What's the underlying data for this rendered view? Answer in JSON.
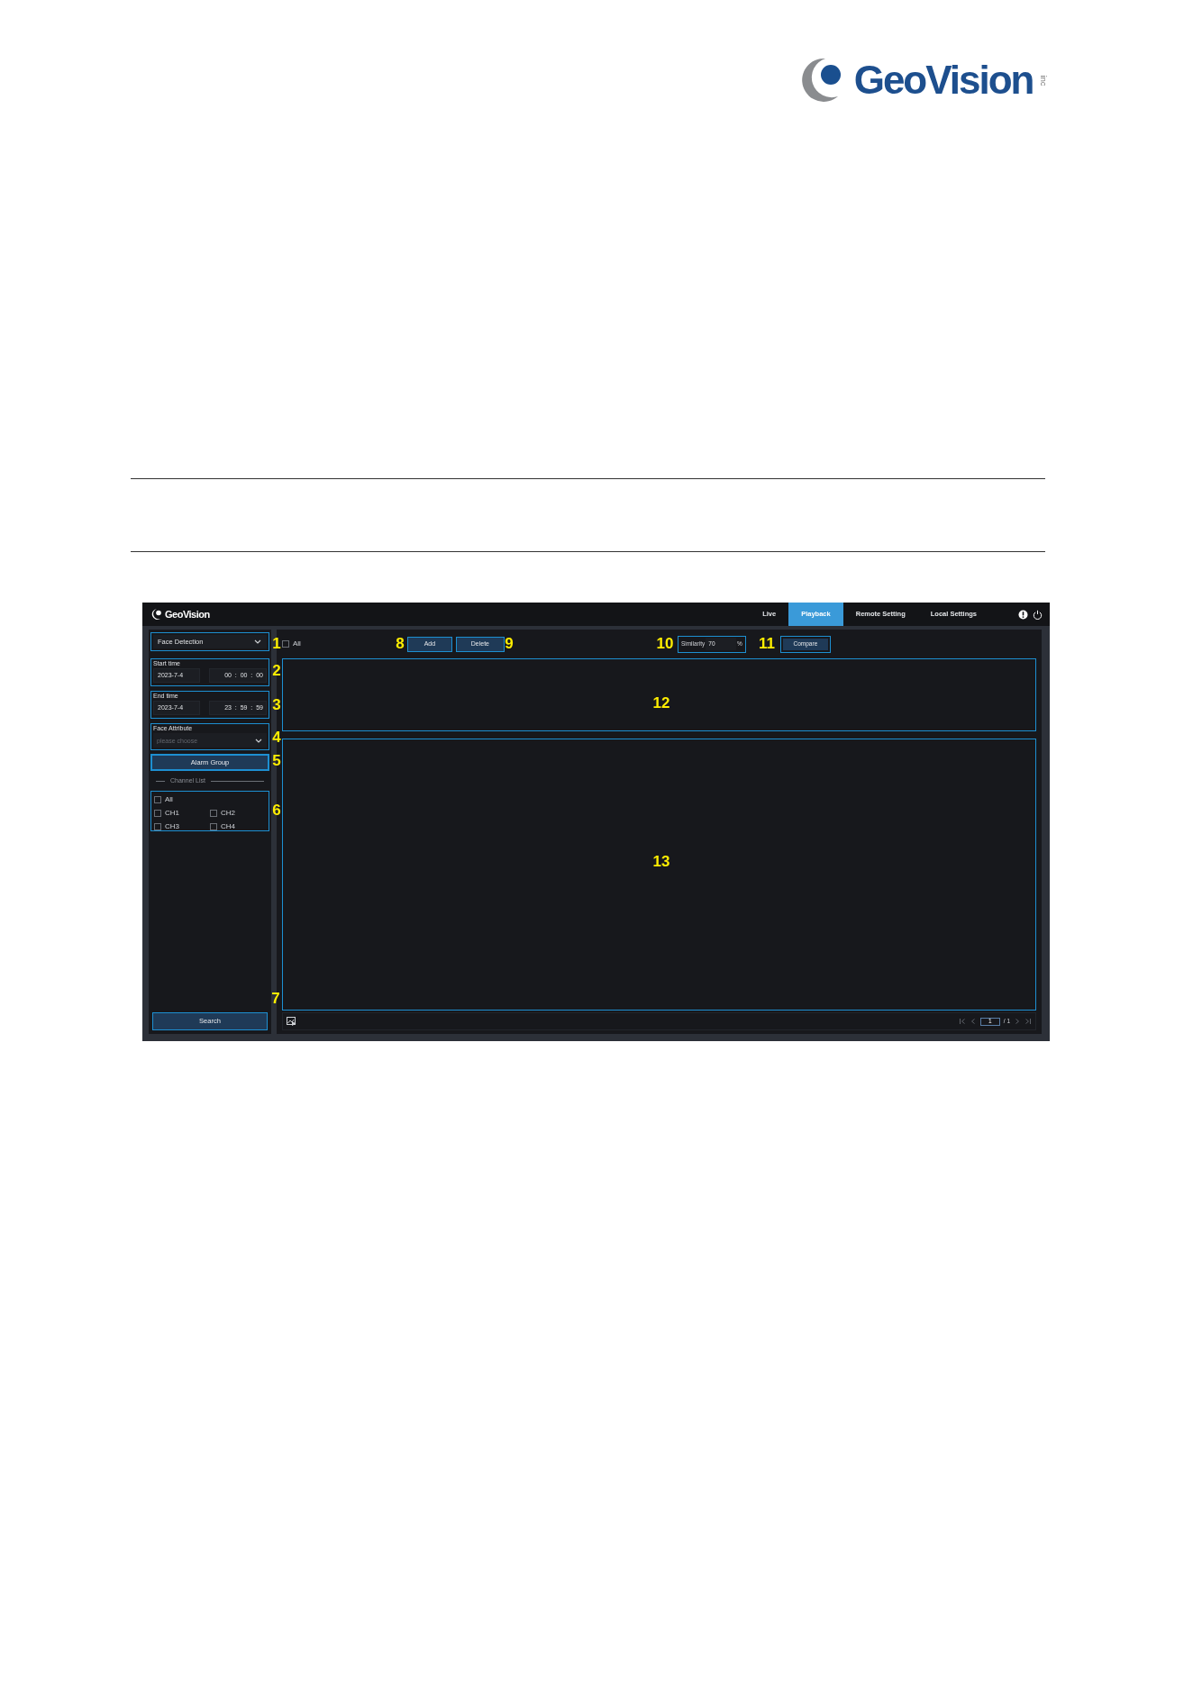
{
  "logo": {
    "name": "GeoVision",
    "suffix": "inc"
  },
  "app": {
    "brand": "GeoVision",
    "nav": [
      {
        "label": "Live",
        "selected": false
      },
      {
        "label": "Playback",
        "selected": true
      },
      {
        "label": "Remote Setting",
        "selected": false
      },
      {
        "label": "Local Settings",
        "selected": false
      }
    ],
    "sidebar": {
      "mode": "Face Detection",
      "times": [
        {
          "label": "Start time",
          "date": "2023-7-4",
          "time": "00  :  00  :  00"
        },
        {
          "label": "End time",
          "date": "2023-7-4",
          "time": "23  :  59  :  59"
        }
      ],
      "attribute": {
        "label": "Face Attribute",
        "placeholder": "please choose"
      },
      "alarm_button": "Alarm Group",
      "channel_heading": "Channel List",
      "channels": [
        {
          "label": "All",
          "checked": false
        },
        {
          "label": "CH1",
          "checked": false
        },
        {
          "label": "CH2",
          "checked": false
        },
        {
          "label": "CH3",
          "checked": false
        },
        {
          "label": "CH4",
          "checked": false
        }
      ],
      "search_button": "Search"
    },
    "toolbar": {
      "select_all": {
        "label": "All",
        "checked": false
      },
      "add_button": "Add",
      "delete_button": "Delete",
      "similarity": {
        "label": "Similarity",
        "value": "70",
        "unit": "%"
      },
      "compare_button": "Compare"
    },
    "pager": {
      "page": "1",
      "total": "/ 1"
    }
  },
  "callouts": [
    "1",
    "2",
    "3",
    "4",
    "5",
    "6",
    "7",
    "8",
    "9",
    "10",
    "11",
    "12",
    "13"
  ]
}
